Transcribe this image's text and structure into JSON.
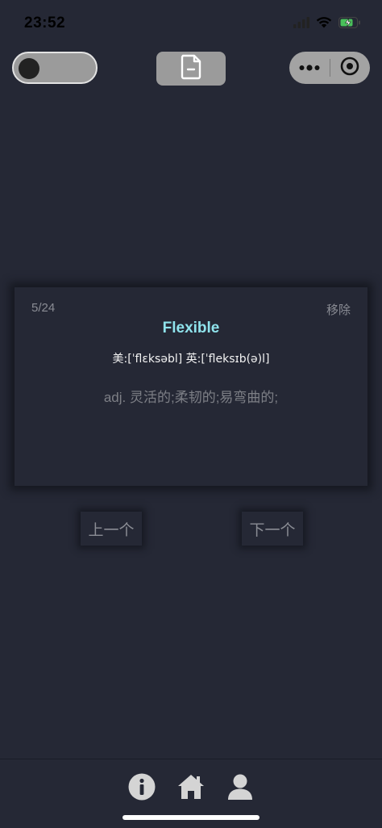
{
  "status_bar": {
    "time": "23:52",
    "icons": [
      "cellular-signal-icon",
      "wifi-icon",
      "battery-charging-icon"
    ]
  },
  "top_bar": {
    "mode_toggle": {
      "state": "off"
    },
    "document_button": {
      "icon": "document-minus-icon"
    },
    "capsule": {
      "more_icon": "more-dots-icon",
      "close_icon": "target-close-icon"
    }
  },
  "card": {
    "counter": "5/24",
    "remove_label": "移除",
    "word": "Flexible",
    "phonetic": "美:[ˈflɛksəbl] 英:[ˈfleksɪb(ə)l]",
    "meaning": "adj. 灵活的;柔韧的;易弯曲的;"
  },
  "navigation": {
    "prev_label": "上一个",
    "next_label": "下一个"
  },
  "tabbar": {
    "items": [
      {
        "icon": "info-icon"
      },
      {
        "icon": "home-icon"
      },
      {
        "icon": "user-icon"
      }
    ]
  },
  "colors": {
    "background": "#252835",
    "word_accent": "#8fe3ec",
    "muted_text": "#8a8c94",
    "control_gray": "#9b9b9b"
  }
}
